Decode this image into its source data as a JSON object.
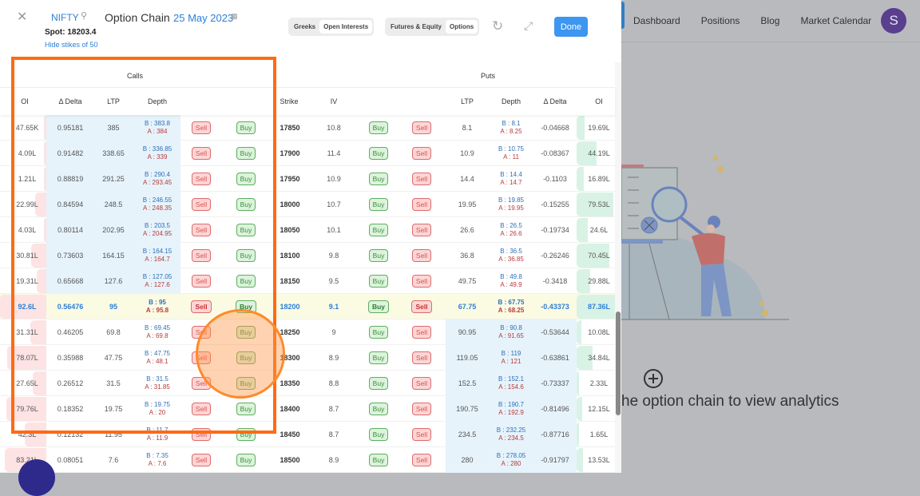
{
  "background": {
    "nav_links": [
      "Dashboard",
      "Positions",
      "Blog",
      "Market Calendar"
    ],
    "avatar_letter": "S",
    "empty_state_text": "he option chain to view analytics"
  },
  "header": {
    "symbol": "NIFTY",
    "title": "Option Chain",
    "expiry_date": "25 May 2023",
    "spot": "Spot: 18203.4",
    "hide_strikes_link": "Hide stikes of 50",
    "toggle_view": {
      "options": [
        "Greeks",
        "Open Interests"
      ],
      "selected": "Open Interests"
    },
    "toggle_segment": {
      "options": [
        "Futures & Equity",
        "Options"
      ],
      "selected": "Options"
    },
    "done_label": "Done"
  },
  "table": {
    "group_calls": "Calls",
    "group_puts": "Puts",
    "columns": [
      "OI",
      "Δ Delta",
      "LTP",
      "Depth",
      "",
      "",
      "Strike",
      "IV",
      "",
      "",
      "LTP",
      "Depth",
      "Δ Delta",
      "OI"
    ],
    "sell_label": "Sell",
    "buy_label": "Buy",
    "atm_strike": "18200",
    "rows": [
      {
        "strike": "17850",
        "iv": "10.8",
        "call": {
          "oi": "47.65K",
          "oi_pct": 0.01,
          "delta": "0.95181",
          "ltp": "385",
          "bid": "B : 383.8",
          "ask": "A : 384"
        },
        "put": {
          "oi": "19.69L",
          "oi_pct": 0.2,
          "delta": "-0.04668",
          "ltp": "8.1",
          "bid": "B : 8.1",
          "ask": "A : 8.25"
        }
      },
      {
        "strike": "17900",
        "iv": "11.4",
        "call": {
          "oi": "4.09L",
          "oi_pct": 0.04,
          "delta": "0.91482",
          "ltp": "338.65",
          "bid": "B : 336.85",
          "ask": "A : 339"
        },
        "put": {
          "oi": "44.19L",
          "oi_pct": 0.5,
          "delta": "-0.08367",
          "ltp": "10.9",
          "bid": "B : 10.75",
          "ask": "A : 11"
        }
      },
      {
        "strike": "17950",
        "iv": "10.9",
        "call": {
          "oi": "1.21L",
          "oi_pct": 0.01,
          "delta": "0.88819",
          "ltp": "291.25",
          "bid": "B : 290.4",
          "ask": "A : 293.45"
        },
        "put": {
          "oi": "16.89L",
          "oi_pct": 0.17,
          "delta": "-0.1103",
          "ltp": "14.4",
          "bid": "B : 14.4",
          "ask": "A : 14.7"
        }
      },
      {
        "strike": "18000",
        "iv": "10.7",
        "call": {
          "oi": "22.99L",
          "oi_pct": 0.25,
          "delta": "0.84594",
          "ltp": "248.5",
          "bid": "B : 246.55",
          "ask": "A : 248.35"
        },
        "put": {
          "oi": "79.53L",
          "oi_pct": 0.91,
          "delta": "-0.15255",
          "ltp": "19.95",
          "bid": "B : 19.85",
          "ask": "A : 19.95"
        }
      },
      {
        "strike": "18050",
        "iv": "10.1",
        "call": {
          "oi": "4.03L",
          "oi_pct": 0.04,
          "delta": "0.80114",
          "ltp": "202.95",
          "bid": "B : 203.5",
          "ask": "A : 204.95"
        },
        "put": {
          "oi": "24.6L",
          "oi_pct": 0.28,
          "delta": "-0.19734",
          "ltp": "26.6",
          "bid": "B : 26.5",
          "ask": "A : 26.6"
        }
      },
      {
        "strike": "18100",
        "iv": "9.8",
        "call": {
          "oi": "30.81L",
          "oi_pct": 0.33,
          "delta": "0.73603",
          "ltp": "164.15",
          "bid": "B : 164.15",
          "ask": "A : 164.7"
        },
        "put": {
          "oi": "70.45L",
          "oi_pct": 0.81,
          "delta": "-0.26246",
          "ltp": "36.8",
          "bid": "B : 36.5",
          "ask": "A : 36.85"
        }
      },
      {
        "strike": "18150",
        "iv": "9.5",
        "call": {
          "oi": "19.31L",
          "oi_pct": 0.21,
          "delta": "0.65668",
          "ltp": "127.6",
          "bid": "B : 127.05",
          "ask": "A : 127.6"
        },
        "put": {
          "oi": "29.88L",
          "oi_pct": 0.34,
          "delta": "-0.3418",
          "ltp": "49.75",
          "bid": "B : 49.8",
          "ask": "A : 49.9"
        }
      },
      {
        "strike": "18200",
        "iv": "9.1",
        "call": {
          "oi": "92.6L",
          "oi_pct": 1.0,
          "delta": "0.56476",
          "ltp": "95",
          "bid": "B : 95",
          "ask": "A : 95.8"
        },
        "put": {
          "oi": "87.36L",
          "oi_pct": 1.0,
          "delta": "-0.43373",
          "ltp": "67.75",
          "bid": "B : 67.75",
          "ask": "A : 68.25"
        }
      },
      {
        "strike": "18250",
        "iv": "9",
        "call": {
          "oi": "31.31L",
          "oi_pct": 0.34,
          "delta": "0.46205",
          "ltp": "69.8",
          "bid": "B : 69.45",
          "ask": "A : 69.8"
        },
        "put": {
          "oi": "10.08L",
          "oi_pct": 0.12,
          "delta": "-0.53644",
          "ltp": "90.95",
          "bid": "B : 90.8",
          "ask": "A : 91.65"
        }
      },
      {
        "strike": "18300",
        "iv": "8.9",
        "call": {
          "oi": "78.07L",
          "oi_pct": 0.84,
          "delta": "0.35988",
          "ltp": "47.75",
          "bid": "B : 47.75",
          "ask": "A : 48.1"
        },
        "put": {
          "oi": "34.84L",
          "oi_pct": 0.4,
          "delta": "-0.63861",
          "ltp": "119.05",
          "bid": "B : 119",
          "ask": "A : 121"
        }
      },
      {
        "strike": "18350",
        "iv": "8.8",
        "call": {
          "oi": "27.65L",
          "oi_pct": 0.3,
          "delta": "0.26512",
          "ltp": "31.5",
          "bid": "B : 31.5",
          "ask": "A : 31.85"
        },
        "put": {
          "oi": "2.33L",
          "oi_pct": 0.03,
          "delta": "-0.73337",
          "ltp": "152.5",
          "bid": "B : 152.1",
          "ask": "A : 154.6"
        }
      },
      {
        "strike": "18400",
        "iv": "8.7",
        "call": {
          "oi": "79.76L",
          "oi_pct": 0.86,
          "delta": "0.18352",
          "ltp": "19.75",
          "bid": "B : 19.75",
          "ask": "A : 20"
        },
        "put": {
          "oi": "12.15L",
          "oi_pct": 0.14,
          "delta": "-0.81496",
          "ltp": "190.75",
          "bid": "B : 190.7",
          "ask": "A : 192.9"
        }
      },
      {
        "strike": "18450",
        "iv": "8.7",
        "call": {
          "oi": "42.3L",
          "oi_pct": 0.46,
          "delta": "0.12132",
          "ltp": "11.95",
          "bid": "B : 11.7",
          "ask": "A : 11.9"
        },
        "put": {
          "oi": "1.65L",
          "oi_pct": 0.02,
          "delta": "-0.87716",
          "ltp": "234.5",
          "bid": "B : 232.25",
          "ask": "A : 234.5"
        }
      },
      {
        "strike": "18500",
        "iv": "8.9",
        "call": {
          "oi": "83.21L",
          "oi_pct": 0.9,
          "delta": "0.08051",
          "ltp": "7.6",
          "bid": "B : 7.35",
          "ask": "A : 7.6"
        },
        "put": {
          "oi": "13.53L",
          "oi_pct": 0.15,
          "delta": "-0.91797",
          "ltp": "280",
          "bid": "B : 278.05",
          "ask": "A : 280"
        }
      }
    ]
  }
}
